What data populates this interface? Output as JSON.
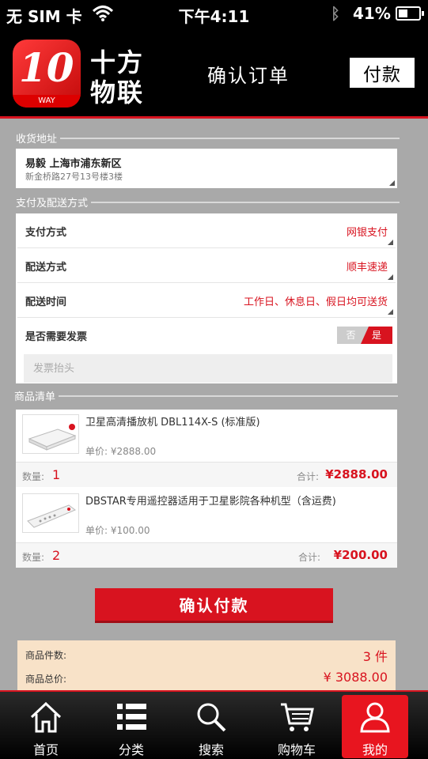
{
  "status_bar": {
    "carrier": "无 SIM 卡",
    "time": "下午4:11",
    "battery": "41%",
    "battery_level": 0.41
  },
  "header": {
    "logo_number": "10",
    "logo_sub": "WAY",
    "brand": [
      "十方",
      "物联"
    ],
    "title": "确认订单",
    "pay_button": "付款"
  },
  "address": {
    "section_title": "收货地址",
    "line1": "易毅  上海市浦东新区",
    "line2": "新金桥路27号13号楼3楼"
  },
  "payment": {
    "section_title": "支付及配送方式",
    "pay_label": "支付方式",
    "pay_value": "网银支付",
    "ship_label": "配送方式",
    "ship_value": "顺丰速递",
    "time_label": "配送时间",
    "time_value": "工作日、休息日、假日均可送货",
    "invoice_label": "是否需要发票",
    "toggle_off": "否",
    "toggle_on": "是",
    "invoice_placeholder": "发票抬头"
  },
  "products": {
    "section_title": "商品清单",
    "qty_label": "数量:",
    "subtotal_label": "合计:",
    "items": [
      {
        "name": "卫星高清播放机 DBL114X-S (标准版)",
        "price": "单价:  ¥2888.00",
        "qty": "1",
        "subtotal": "¥2888.00"
      },
      {
        "name": "DBSTAR专用遥控器适用于卫星影院各种机型（含运费)",
        "price": "单价:  ¥100.00",
        "qty": "2",
        "subtotal": "¥200.00"
      }
    ]
  },
  "confirm_button": "确认付款",
  "summary": {
    "count_label": "商品件数:",
    "count_value": "3 件",
    "total_label": "商品总价:",
    "total_value": "¥ 3088.00"
  },
  "tabs": [
    {
      "label": "首页",
      "icon": "home-icon"
    },
    {
      "label": "分类",
      "icon": "category-list-icon"
    },
    {
      "label": "搜索",
      "icon": "search-icon"
    },
    {
      "label": "购物车",
      "icon": "cart-icon"
    },
    {
      "label": "我的",
      "icon": "user-icon",
      "active": true
    }
  ],
  "colors": {
    "accent": "#d8131f",
    "background": "#a9a9a9",
    "header": "#000000",
    "summary_bg": "#f8e2c8"
  }
}
